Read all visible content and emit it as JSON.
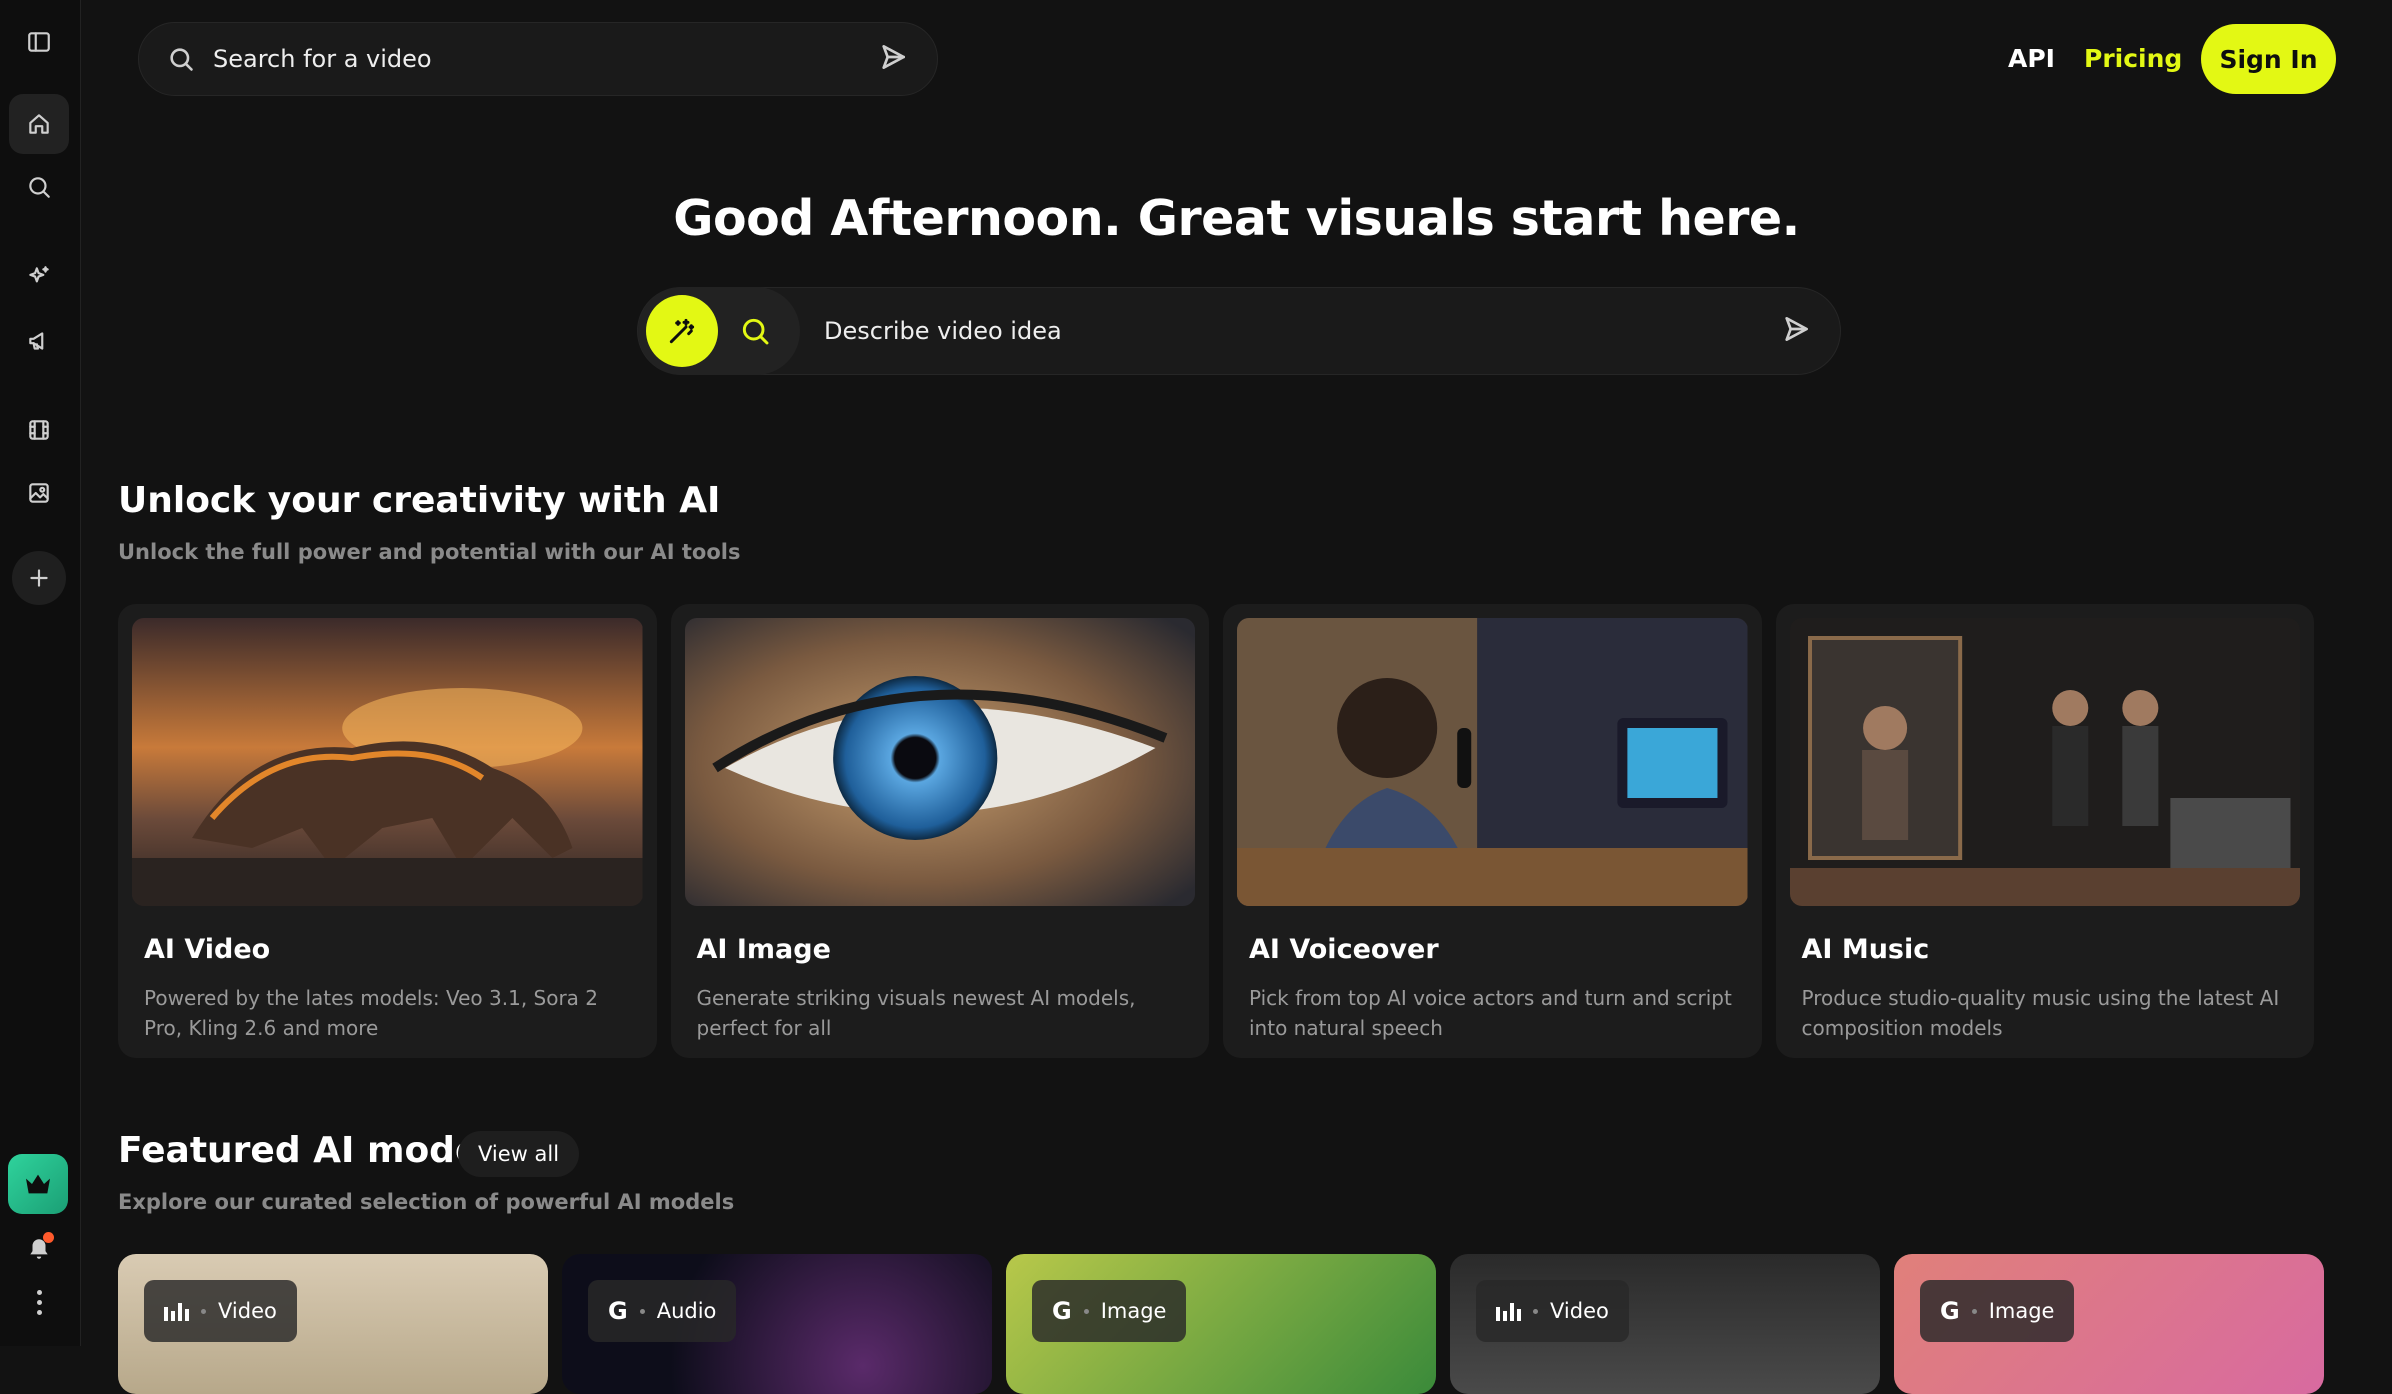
{
  "sidebar": {
    "items": [
      {
        "icon": "sidebar-toggle-icon"
      },
      {
        "icon": "home-icon"
      },
      {
        "icon": "search-icon"
      },
      {
        "icon": "sparkles-icon"
      },
      {
        "icon": "megaphone-icon"
      },
      {
        "icon": "film-icon"
      },
      {
        "icon": "image-icon"
      },
      {
        "icon": "plus-icon"
      }
    ],
    "bottom": [
      "crown-icon",
      "bell-icon",
      "more-vertical-icon"
    ]
  },
  "topbar": {
    "search_placeholder": "Search for a video",
    "nav_api": "API",
    "nav_pricing": "Pricing",
    "signin": "Sign In"
  },
  "hero": {
    "title": "Good Afternoon. Great visuals start here.",
    "input_placeholder": "Describe video idea"
  },
  "tools_section": {
    "title": "Unlock your creativity with AI",
    "subtitle": "Unlock the full power and potential with our AI tools",
    "cards": [
      {
        "name": "AI Video",
        "desc": "Powered by the lates models: Veo 3.1, Sora 2 Pro, Kling 2.6 and more"
      },
      {
        "name": "AI Image",
        "desc": "Generate striking visuals newest AI models, perfect for all"
      },
      {
        "name": "AI Voiceover",
        "desc": "Pick from top AI voice actors and turn and script into natural speech"
      },
      {
        "name": "AI Music",
        "desc": "Produce studio-quality music using the latest AI composition models"
      }
    ]
  },
  "featured_section": {
    "title": "Featured AI models",
    "view_all": "View all",
    "subtitle": "Explore our curated selection of powerful AI models",
    "models": [
      {
        "provider_icon": "bars-icon",
        "type": "Video"
      },
      {
        "provider_icon": "G",
        "type": "Audio"
      },
      {
        "provider_icon": "G",
        "type": "Image"
      },
      {
        "provider_icon": "bars-icon",
        "type": "Video"
      },
      {
        "provider_icon": "G",
        "type": "Image"
      }
    ]
  },
  "colors": {
    "accent": "#e3f814",
    "background": "#121212",
    "card": "#1c1c1c",
    "crown": "#2fd39c"
  }
}
